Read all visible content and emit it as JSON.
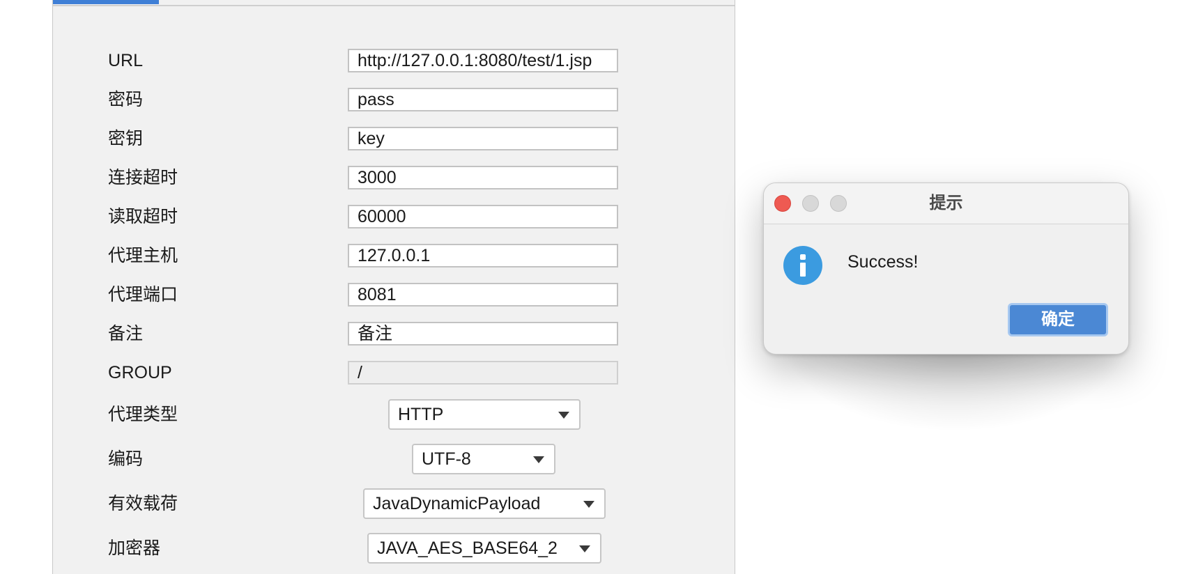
{
  "form": {
    "fields": [
      {
        "label": "URL",
        "value": "http://127.0.0.1:8080/test/1.jsp"
      },
      {
        "label": "密码",
        "value": "pass"
      },
      {
        "label": "密钥",
        "value": "key"
      },
      {
        "label": "连接超时",
        "value": "3000"
      },
      {
        "label": "读取超时",
        "value": "60000"
      },
      {
        "label": "代理主机",
        "value": "127.0.0.1"
      },
      {
        "label": "代理端口",
        "value": "8081"
      },
      {
        "label": "备注",
        "value": "备注"
      },
      {
        "label": "GROUP",
        "value": "/"
      }
    ],
    "selects": [
      {
        "label": "代理类型",
        "value": "HTTP"
      },
      {
        "label": "编码",
        "value": "UTF-8"
      },
      {
        "label": "有效载荷",
        "value": "JavaDynamicPayload"
      },
      {
        "label": "加密器",
        "value": "JAVA_AES_BASE64_2"
      }
    ]
  },
  "dialog": {
    "title": "提示",
    "message": "Success!",
    "confirm_label": "确定",
    "icon": "info-icon"
  },
  "colors": {
    "accent": "#3f7fd6",
    "confirm_button": "#4b88d4",
    "info_icon": "#3b9be0",
    "close_button": "#ee5a52"
  }
}
